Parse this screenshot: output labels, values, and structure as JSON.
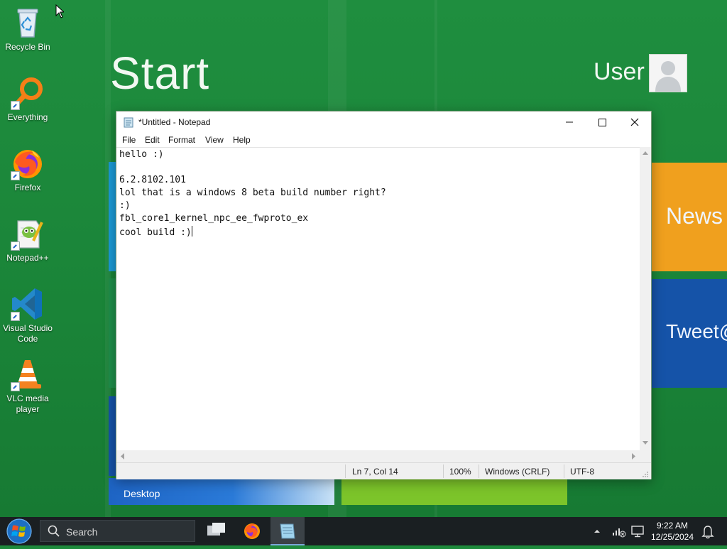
{
  "start_screen": {
    "title": "Start",
    "user": "User",
    "tiles": {
      "news": "News",
      "tweet": "Tweet@",
      "desktop": "Desktop"
    }
  },
  "desktop_icons": [
    {
      "label": "Recycle Bin"
    },
    {
      "label": "Everything"
    },
    {
      "label": "Firefox"
    },
    {
      "label": "Notepad++"
    },
    {
      "label": "Visual Studio Code"
    },
    {
      "label": "VLC media player"
    }
  ],
  "notepad": {
    "title": "*Untitled - Notepad",
    "menu": [
      "File",
      "Edit",
      "Format",
      "View",
      "Help"
    ],
    "lines": [
      "hello :)",
      "",
      "6.2.8102.101",
      "lol that is a windows 8 beta build number right?",
      ":)",
      "fbl_core1_kernel_npc_ee_fwproto_ex",
      "cool build :)"
    ],
    "status": {
      "position": "Ln 7, Col 14",
      "zoom": "100%",
      "line_endings": "Windows (CRLF)",
      "encoding": "UTF-8"
    }
  },
  "taskbar": {
    "search_placeholder": "Search",
    "time": "9:22 AM",
    "date": "12/25/2024"
  },
  "colors": {
    "background": "#1e8a3c",
    "tile_orange": "#f0a01e",
    "tile_blue": "#1553a8",
    "tile_desktop": "#2a6ec8",
    "tile_green": "#7cc42a",
    "taskbar": "#1a1f22"
  }
}
